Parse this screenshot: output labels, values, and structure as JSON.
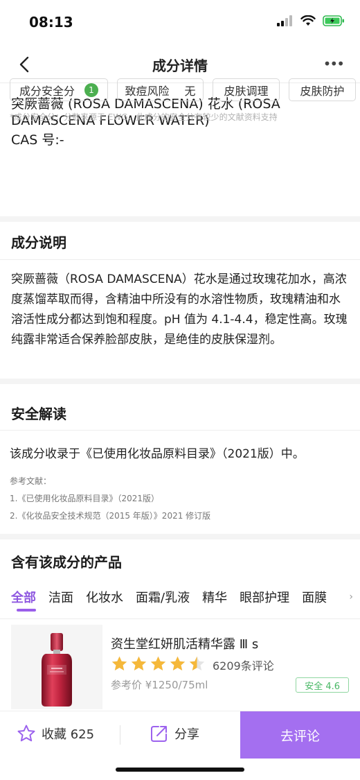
{
  "status_bar": {
    "time": "08:13"
  },
  "nav": {
    "title": "成分详情",
    "more": "•••"
  },
  "ingredient": {
    "name": "突厥蔷薇 (ROSA DAMASCENA) 花水 (ROSA DAMASCENA FLOWER WATER)",
    "cas": "CAS 号:-"
  },
  "tags": {
    "safety_label": "成分安全分",
    "safety_score": "1",
    "acne_label": "致痘风险",
    "acne_value": "无",
    "function1": "皮肤调理",
    "function2": "皮肤防护"
  },
  "note": "*成分安全分：分数来源于 EWG，此成分的安全分有较少的文献资料支持",
  "description": {
    "title": "成分说明",
    "text": "突厥蔷薇（ROSA DAMASCENA）花水是通过玫瑰花加水，高浓度蒸馏萃取而得，含精油中所没有的水溶性物质，玫瑰精油和水溶活性成分都达到饱和程度。pH 值为 4.1-4.4，稳定性高。玫瑰纯露非常适合保养脸部皮肤，是绝佳的皮肤保湿剂。"
  },
  "safety": {
    "title": "安全解读",
    "text": "该成分收录于《已使用化妆品原料目录》（2021版）中。",
    "ref_title": "参考文献：",
    "refs": [
      "1.《已使用化妆品原料目录》（2021版）",
      "2.《化妆品安全技术规范（2015 年版）》2021 修订版"
    ]
  },
  "products": {
    "title": "含有该成分的产品",
    "tabs": [
      "全部",
      "洁面",
      "化妆水",
      "面霜/乳液",
      "精华",
      "眼部护理",
      "面膜"
    ],
    "active_tab": 0,
    "items": [
      {
        "name": "资生堂红妍肌活精华露 Ⅲ s",
        "rating": 4.5,
        "reviews": "6209条评论",
        "price": "参考价 ¥1250/75ml",
        "safe_badge": "安全 4.6"
      }
    ]
  },
  "bottom_bar": {
    "favorite": "收藏 625",
    "share": "分享",
    "review": "去评论"
  },
  "colors": {
    "accent": "#a46ff0",
    "tab_active": "#8e57e0",
    "score_green": "#4caf50",
    "star": "#f5b83a"
  }
}
